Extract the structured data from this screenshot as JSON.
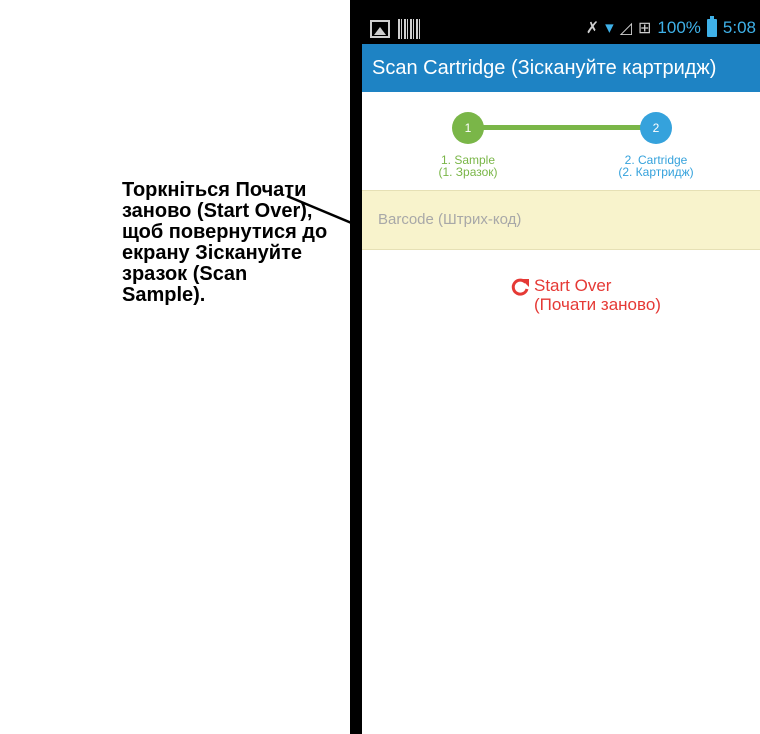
{
  "callout": {
    "text": "Торкніться Почати\nзаново (Start Over),\nщоб повернутися до\nекрану Зіскануйте\nзразок (Scan Sample)."
  },
  "status_bar": {
    "battery": "100%",
    "time": "5:08"
  },
  "header": {
    "title": "Scan Cartridge (Зіскануйте картридж)"
  },
  "stepper": {
    "steps": [
      {
        "number": "1",
        "label": "1. Sample\n(1. Зразок)",
        "color": "#7ab648"
      },
      {
        "number": "2",
        "label": "2. Cartridge\n(2. Картридж)",
        "color": "#35a2dc"
      }
    ]
  },
  "barcode": {
    "label": "Barcode (Штрих-код)"
  },
  "start_over": {
    "label": "Start Over\n(Почати заново)",
    "color": "#e53935"
  },
  "colors": {
    "header_bg": "#1e83c4",
    "barcode_bg": "#f8f3cc"
  }
}
